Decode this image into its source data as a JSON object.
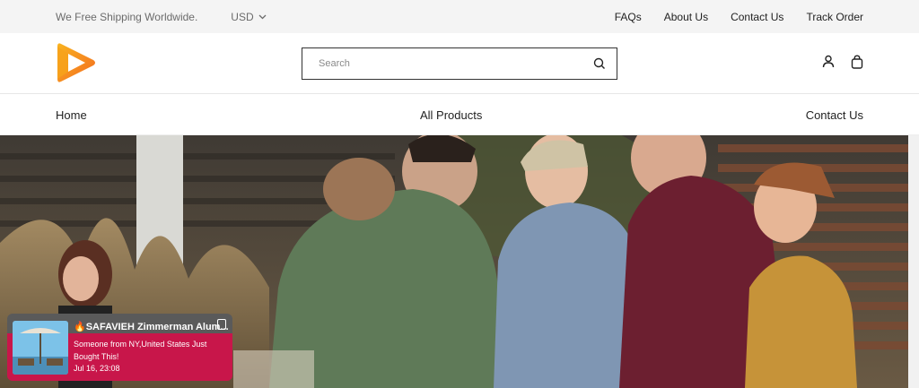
{
  "topbar": {
    "shipping_text": "We Free Shipping Worldwide.",
    "currency": "USD",
    "links": [
      "FAQs",
      "About Us",
      "Contact Us",
      "Track Order"
    ]
  },
  "header": {
    "search_placeholder": "Search",
    "icons": [
      "account-icon",
      "cart-bag-icon",
      "search-icon"
    ],
    "logo_colors": [
      "#f7a21b",
      "#f36b21"
    ]
  },
  "nav": {
    "items": [
      "Home",
      "All Products",
      "Contact Us"
    ]
  },
  "popup": {
    "title": "SAFAVIEH Zimmerman Alum...",
    "message": "Someone from NY,United States Just Bought This!",
    "time": "Jul 16, 23:08",
    "colors": {
      "top": "#5a5a5a",
      "bottom": "#c8164a"
    }
  }
}
